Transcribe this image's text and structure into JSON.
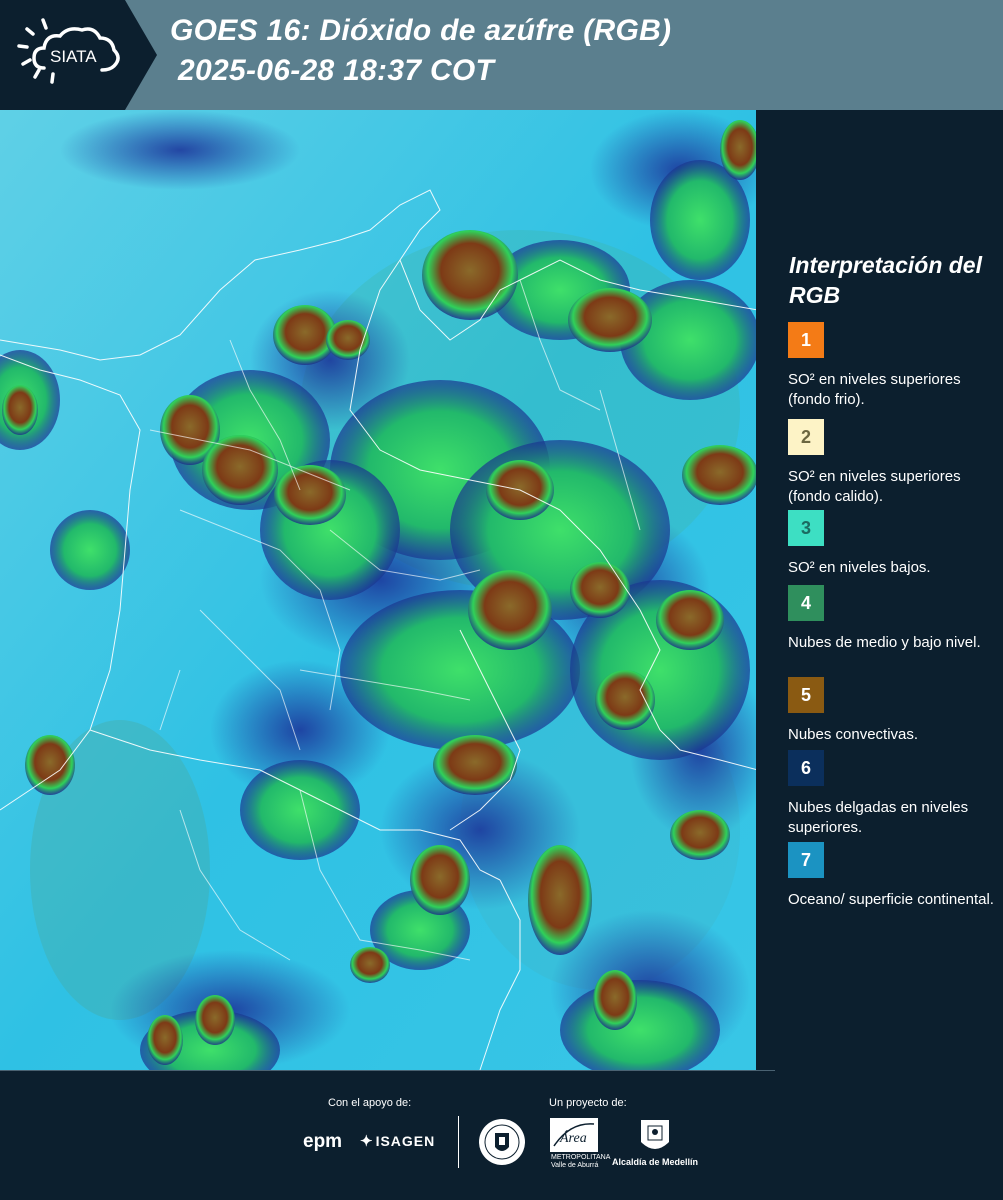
{
  "header": {
    "logo_text": "SIATA",
    "title": "GOES 16: Dióxido de azúfre (RGB)",
    "datetime": "2025-06-28 18:37 COT"
  },
  "map": {
    "background_color": "#2ec3e3",
    "description_colors": {
      "ocean": "#2ec3e3",
      "convective": "#8a5a1e",
      "low_mid_cloud": "#2bd96a",
      "thin_high_cloud": "#1c2a8c",
      "border": "#ffffff"
    }
  },
  "legend": {
    "title": "Interpretación del RGB",
    "items": [
      {
        "number": "1",
        "color": "#f47b16",
        "text_color": "#ffffff",
        "label": "SO² en niveles superiores (fondo frio)."
      },
      {
        "number": "2",
        "color": "#fdf3c6",
        "text_color": "#6b6640",
        "label": "SO² en niveles superiores (fondo calido)."
      },
      {
        "number": "3",
        "color": "#3ddfc3",
        "text_color": "#1b6b61",
        "label": "SO² en niveles bajos."
      },
      {
        "number": "4",
        "color": "#2f8f5d",
        "text_color": "#ffffff",
        "label": "Nubes de medio y bajo nivel."
      },
      {
        "number": "5",
        "color": "#8a5a12",
        "text_color": "#ffffff",
        "label": "Nubes convectivas."
      },
      {
        "number": "6",
        "color": "#0b2f5c",
        "text_color": "#ffffff",
        "label": "Nubes delgadas en niveles superiores."
      },
      {
        "number": "7",
        "color": "#1b93c2",
        "text_color": "#ffffff",
        "label": "Oceano/ superficie continental."
      }
    ]
  },
  "footer": {
    "support_label": "Con el apoyo de:",
    "project_label": "Un proyecto de:",
    "sponsors": [
      "epm",
      "ISAGEN"
    ],
    "partners": {
      "amva_name": "Área",
      "amva_caption": "METROPOLITANA\nValle de Aburrá",
      "medellin_caption": "Alcaldía de Medellín"
    }
  }
}
